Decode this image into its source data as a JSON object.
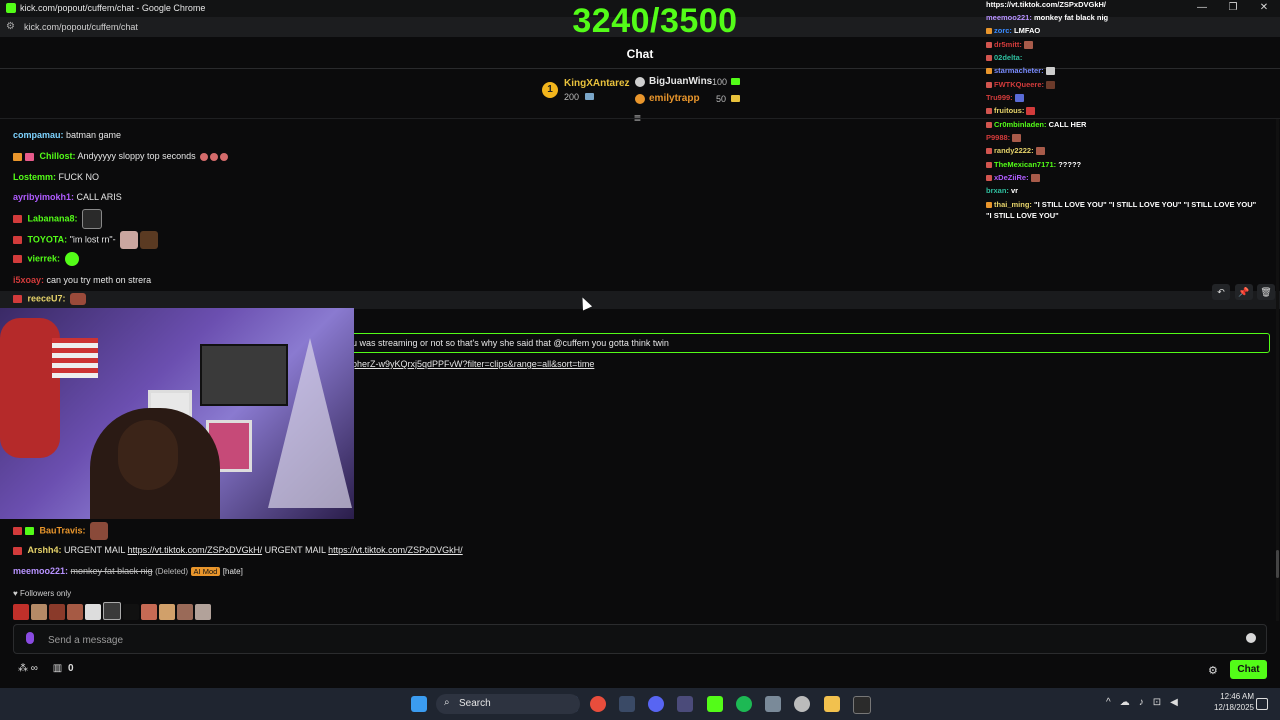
{
  "window": {
    "title": "kick.com/popout/cuffem/chat - Google Chrome",
    "url": "kick.com/popout/cuffem/chat",
    "min_label": "—",
    "max_label": "❐",
    "close_label": "✕"
  },
  "goal": {
    "text": "3240/3500",
    "current": 3240,
    "target": 3500
  },
  "chat_title": "Chat",
  "leaderboard": {
    "first": {
      "rank": "1",
      "name": "KingXAntarez",
      "value": "200"
    },
    "second": {
      "name": "BigJuanWins",
      "value": "100"
    },
    "third": {
      "name": "emilytrapp",
      "value": "50"
    }
  },
  "overlay": [
    {
      "user": "",
      "text": "https://vt.tiktok.com/ZSPxDVGkH/",
      "color": "#ffffff"
    },
    {
      "user": "meemoo221:",
      "text": "monkey fat black nig",
      "color": "#b792ff"
    },
    {
      "user": "zorc:",
      "text": "LMFAO",
      "color": "#3a8bff"
    },
    {
      "user": "dr5mitt:",
      "text": "",
      "color": "#d23b3b"
    },
    {
      "user": "02delta:",
      "text": "",
      "color": "#2fbf9f"
    },
    {
      "user": "starmacheter:",
      "text": "",
      "color": "#7a8cff"
    },
    {
      "user": "FWTKQueere:",
      "text": "",
      "color": "#d23b3b"
    },
    {
      "user": "Tru999:",
      "text": "",
      "color": "#d23b3b"
    },
    {
      "user": "fruitous:",
      "text": "",
      "color": "#e6d36a"
    },
    {
      "user": "Cr0mbinladen:",
      "text": "CALL HER",
      "color": "#53fc18"
    },
    {
      "user": "P9988:",
      "text": "",
      "color": "#d23b3b"
    },
    {
      "user": "randy2222:",
      "text": "",
      "color": "#e6d36a"
    },
    {
      "user": "TheMexican7171:",
      "text": "?????",
      "color": "#53fc18"
    },
    {
      "user": "xDeZiiRe:",
      "text": "",
      "color": "#b05cff"
    },
    {
      "user": "brxan:",
      "text": "vr",
      "color": "#2fbf9f"
    },
    {
      "user": "thai_ming:",
      "text": "\"I STILL LOVE YOU\" \"I STILL LOVE YOU\" \"I STILL LOVE YOU\"",
      "color": "#e6d36a"
    },
    {
      "user": "",
      "text": "\"I STILL LOVE YOU\"",
      "color": "#ffffff"
    }
  ],
  "messages": {
    "m1": {
      "user": "compamau:",
      "text": "batman game",
      "color": "#7dd3ff"
    },
    "m2": {
      "user": "Chillost:",
      "text": "Andyyyyy sloppy top seconds",
      "color": "#53fc18"
    },
    "m3": {
      "user": "Lostemm:",
      "text": "FUCK NO",
      "color": "#53fc18"
    },
    "m4": {
      "user": "ayribyimokh1:",
      "text": "CALL ARIS",
      "color": "#b05cff"
    },
    "m5": {
      "user": "Labanana8:",
      "text": "",
      "color": "#53fc18"
    },
    "m6": {
      "user": "TOYOTA:",
      "text": "\"im lost rn\"-",
      "color": "#53fc18"
    },
    "m7": {
      "user": "vierrek:",
      "text": "",
      "color": "#53fc18"
    },
    "m8": {
      "user": "i5xoay:",
      "text": "can you try meth on strera",
      "color": "#d23b3b"
    },
    "m9": {
      "user": "reeceU7:",
      "text": "",
      "color": "#e6d36a"
    },
    "m10": {
      "user": "BauTravis:",
      "text": "",
      "color": "#e9962c"
    },
    "m11": {
      "user": "Arshh4:",
      "text_a": "URGENT MAIL",
      "link_a": "https://vt.tiktok.com/ZSPxDVGkH/",
      "text_b": "URGENT MAIL",
      "link_b": "https://vt.tiktok.com/ZSPxDVGkH/",
      "color": "#e6d36a"
    },
    "m12": {
      "user": "meemoo221:",
      "text": "monkey fat black nig",
      "deleted_tag": "(Deleted)",
      "ai_tag": "AI Mod",
      "hate_tag": "[hate]",
      "color": "#b792ff"
    }
  },
  "reply": {
    "text": "u was streaming or not so that's why she said that @cuffem you gotta think twin",
    "link": "pherZ-w9yKQrxj5qdPPFvW?filter=clips&range=all&sort=time"
  },
  "hover_actions": {
    "reply": "↶",
    "pin": "📌",
    "delete": "🗑"
  },
  "followers_only": "Followers only",
  "input": {
    "placeholder": "Send a message"
  },
  "bottom_left": {
    "count": "0"
  },
  "chat_button": "Chat",
  "taskbar": {
    "search": "Search",
    "time": "12:46 AM",
    "date": "12/18/2025"
  },
  "colors": {
    "accent": "#53fc18",
    "background": "#0b0b0c"
  }
}
